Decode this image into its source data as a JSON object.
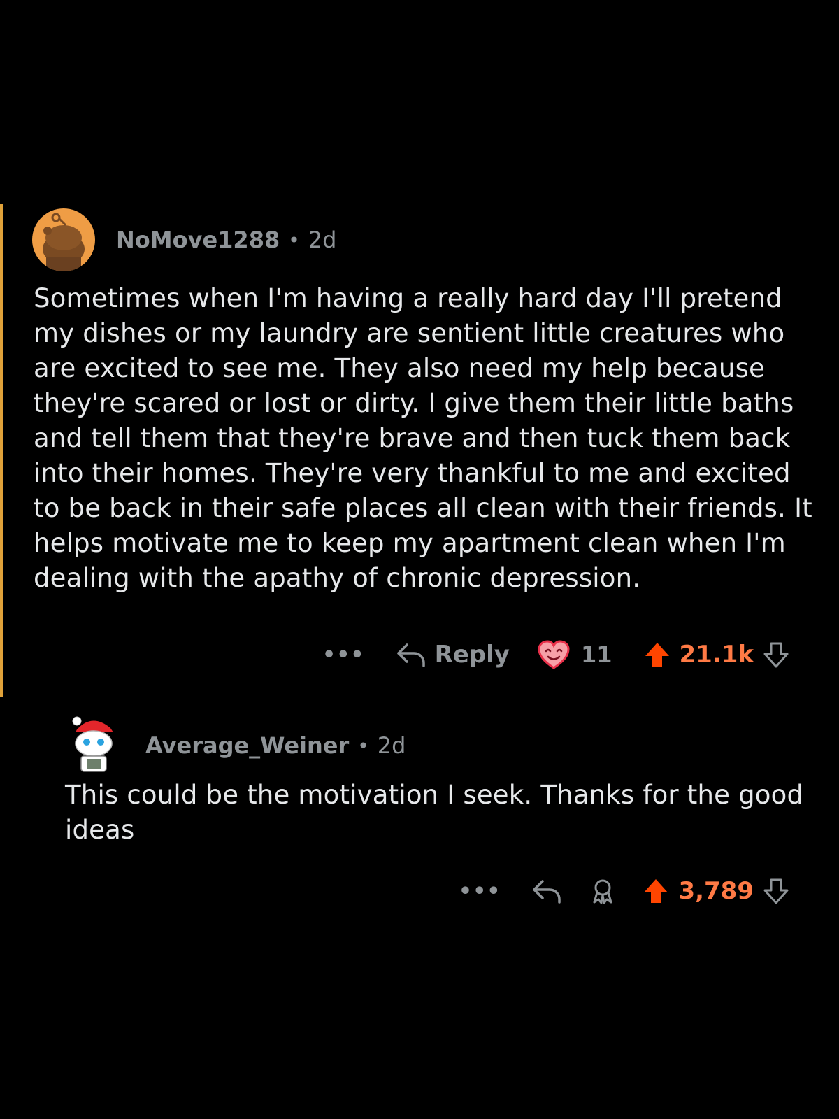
{
  "comments": [
    {
      "author": "NoMove1288",
      "separator": "•",
      "age": "2d",
      "body": "Sometimes when I'm having a really hard day I'll pretend my dishes or my laundry are sentient little creatures who are excited to see me. They also need my help because they're scared or lost or dirty. I give them their little baths and tell them that they're brave and then tuck them back into their homes. They're very thankful to me and excited to be back in their safe places all clean with their friends. It helps motivate me to keep my apartment clean when I'm dealing with the apathy of chronic depression.",
      "more_label": "•••",
      "reply_label": "Reply",
      "award_count": "11",
      "score": "21.1k",
      "avatar_icon": "snoo-avatar-orange",
      "award_icon": "heart-face-award-icon"
    },
    {
      "author": "Average_Weiner",
      "separator": "•",
      "age": "2d",
      "body": "This could be the motivation I seek. Thanks for the good ideas",
      "more_label": "•••",
      "score": "3,789",
      "avatar_icon": "snoo-avatar-red-cap",
      "award_icon": "award-outline-icon"
    }
  ],
  "colors": {
    "background": "#000000",
    "thread_line": "#e0a23a",
    "upvote": "#ff4500",
    "score": "#ff7a45",
    "meta": "#8f9498",
    "body": "#e6e8ea"
  }
}
